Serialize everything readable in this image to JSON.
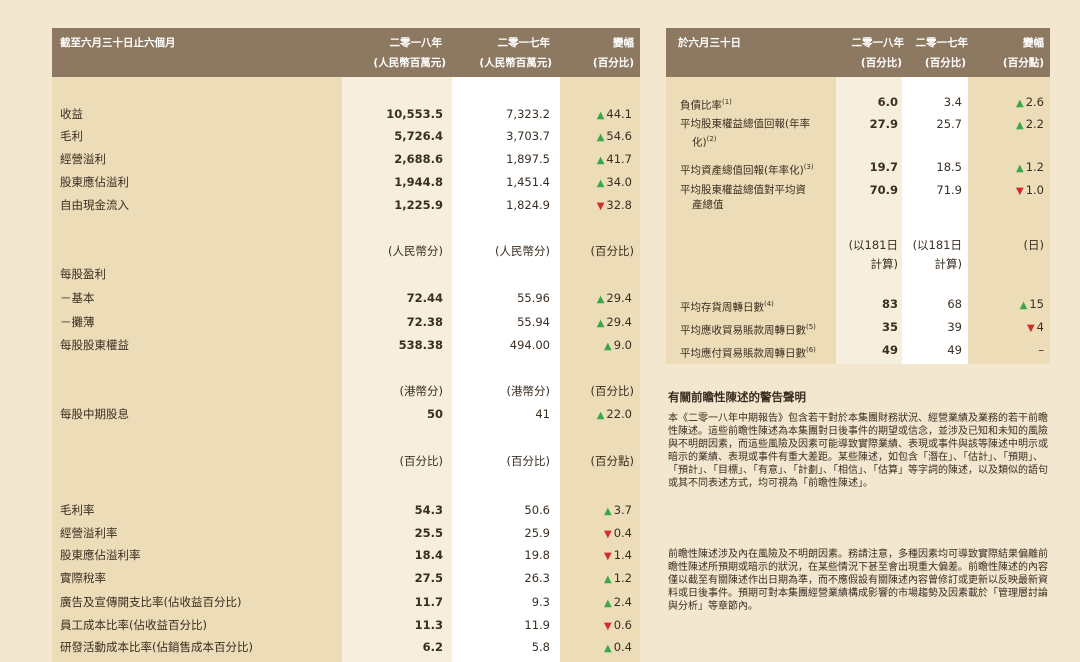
{
  "left_table": {
    "header": {
      "period": "截至六月三十日止六個月",
      "col2018": "二零一八年",
      "col2017": "二零一七年",
      "change": "變幅",
      "unit_2018": "(人民幣百萬元)",
      "unit_2017": "(人民幣百萬元)",
      "unit_change": "(百分比)"
    },
    "rows_a": [
      {
        "label": "收益",
        "v2018": "10,553.5",
        "v2017": "7,323.2",
        "dir": "up",
        "chg": "44.1"
      },
      {
        "label": "毛利",
        "v2018": "5,726.4",
        "v2017": "3,703.7",
        "dir": "up",
        "chg": "54.6"
      },
      {
        "label": "經營溢利",
        "v2018": "2,688.6",
        "v2017": "1,897.5",
        "dir": "up",
        "chg": "41.7"
      },
      {
        "label": "股東應佔溢利",
        "v2018": "1,944.8",
        "v2017": "1,451.4",
        "dir": "up",
        "chg": "34.0"
      },
      {
        "label": "自由現金流入",
        "v2018": "1,225.9",
        "v2017": "1,824.9",
        "dir": "down",
        "chg": "32.8"
      }
    ],
    "unit_row_b": {
      "u2018": "(人民幣分)",
      "u2017": "(人民幣分)",
      "uchg": "(百分比)"
    },
    "eps_heading": "每股盈利",
    "rows_b": [
      {
        "label": "－基本",
        "v2018": "72.44",
        "v2017": "55.96",
        "dir": "up",
        "chg": "29.4"
      },
      {
        "label": "－攤薄",
        "v2018": "72.38",
        "v2017": "55.94",
        "dir": "up",
        "chg": "29.4"
      },
      {
        "label": "每股股東權益",
        "v2018": "538.38",
        "v2017": "494.00",
        "dir": "up",
        "chg": "9.0"
      }
    ],
    "unit_row_c": {
      "u2018": "(港幣分)",
      "u2017": "(港幣分)",
      "uchg": "(百分比)"
    },
    "rows_c": [
      {
        "label": "每股中期股息",
        "v2018": "50",
        "v2017": "41",
        "dir": "up",
        "chg": "22.0"
      }
    ],
    "unit_row_d": {
      "u2018": "(百分比)",
      "u2017": "(百分比)",
      "uchg": "(百分點)"
    },
    "rows_d": [
      {
        "label": "毛利率",
        "v2018": "54.3",
        "v2017": "50.6",
        "dir": "up",
        "chg": "3.7"
      },
      {
        "label": "經營溢利率",
        "v2018": "25.5",
        "v2017": "25.9",
        "dir": "down",
        "chg": "0.4"
      },
      {
        "label": "股東應佔溢利率",
        "v2018": "18.4",
        "v2017": "19.8",
        "dir": "down",
        "chg": "1.4"
      },
      {
        "label": "實際稅率",
        "v2018": "27.5",
        "v2017": "26.3",
        "dir": "up",
        "chg": "1.2"
      },
      {
        "label": "廣告及宣傳開支比率(佔收益百分比)",
        "v2018": "11.7",
        "v2017": "9.3",
        "dir": "up",
        "chg": "2.4"
      },
      {
        "label": "員工成本比率(佔收益百分比)",
        "v2018": "11.3",
        "v2017": "11.9",
        "dir": "down",
        "chg": "0.6"
      },
      {
        "label": "研發活動成本比率(佔銷售成本百分比)",
        "v2018": "6.2",
        "v2017": "5.8",
        "dir": "up",
        "chg": "0.4"
      }
    ]
  },
  "right_table": {
    "header": {
      "period": "於六月三十日",
      "col2018": "二零一八年",
      "col2017": "二零一七年",
      "change": "變幅",
      "unit_2018": "(百分比)",
      "unit_2017": "(百分比)",
      "unit_change": "(百分點)"
    },
    "rows_a": [
      {
        "label1": "負債比率",
        "label2": "",
        "note": "(1)",
        "v2018": "6.0",
        "v2017": "3.4",
        "dir": "up",
        "chg": "2.6"
      },
      {
        "label1": "平均股東權益總值回報(年率",
        "label2": "化)",
        "note": "(2)",
        "v2018": "27.9",
        "v2017": "25.7",
        "dir": "up",
        "chg": "2.2"
      },
      {
        "label1": "平均資產總值回報(年率化)",
        "label2": "",
        "note": "(3)",
        "v2018": "19.7",
        "v2017": "18.5",
        "dir": "up",
        "chg": "1.2"
      },
      {
        "label1": "平均股東權益總值對平均資",
        "label2": "產總值",
        "note": "",
        "v2018": "70.9",
        "v2017": "71.9",
        "dir": "down",
        "chg": "1.0"
      }
    ],
    "unit_row_b": {
      "u2018a": "(以181日",
      "u2018b": "計算)",
      "u2017a": "(以181日",
      "u2017b": "計算)",
      "uchg": "(日)"
    },
    "rows_b": [
      {
        "label": "平均存貨周轉日數",
        "note": "(4)",
        "v2018": "83",
        "v2017": "68",
        "dir": "up",
        "chg": "15"
      },
      {
        "label": "平均應收貿易賬款周轉日數",
        "note": "(5)",
        "v2018": "35",
        "v2017": "39",
        "dir": "down",
        "chg": "4"
      },
      {
        "label": "平均應付貿易賬款周轉日數",
        "note": "(6)",
        "v2018": "49",
        "v2017": "49",
        "dir": "none",
        "chg": "–"
      }
    ]
  },
  "warning": {
    "title": "有關前瞻性陳述的警告聲明",
    "para1": "本《二零一八年中期報告》包含若干對於本集團財務狀況、經營業績及業務的若干前瞻性陳述。這些前瞻性陳述為本集團對日後事件的期望或信念，並涉及已知和未知的風險與不明朗因素，而這些風險及因素可能導致實際業績、表現或事件與該等陳述中明示或暗示的業績、表現或事件有重大差距。某些陳述，如包含「潛在」、「估計」、「預期」、「預計」、「目標」、「有意」、「計劃」、「相信」、「估算」等字詞的陳述，以及類似的語句或其不同表述方式，均可視為「前瞻性陳述」。",
    "para2": "前瞻性陳述涉及內在風險及不明朗因素。務請注意，多種因素均可導致實際結果偏離前瞻性陳述所預期或暗示的狀況，在某些情況下甚至會出現重大偏差。前瞻性陳述的內容僅以截至有關陳述作出日期為準，而不應假設有關陳述內容曾修訂或更新以反映最新資料或日後事件。預期可對本集團經營業績構成影響的市場趨勢及因素載於「管理層討論與分析」等章節內。"
  },
  "colors": {
    "up": "#3aa84a",
    "down": "#d42b2b",
    "header": "#8d7961",
    "panel": "#ecdcb7"
  }
}
